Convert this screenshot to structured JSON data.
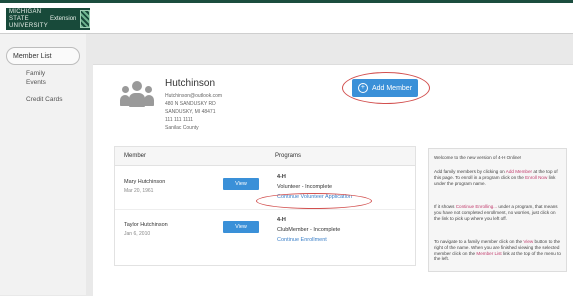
{
  "header": {
    "logo_line1": "MICHIGAN STATE UNIVERSITY",
    "logo_line2": "Extension"
  },
  "sidebar": {
    "member_list_label": "Member List",
    "items": [
      {
        "label": "Family"
      },
      {
        "label": "Events"
      },
      {
        "label": "Credit Cards"
      }
    ]
  },
  "household": {
    "name": "Hutchinson",
    "email": "Hutchinson@outlook.com",
    "address1": "480 N SANDUSKY RD",
    "address2": "SANDUSKY, MI 48471",
    "phone": "111 111 1111",
    "county": "Sanilac County"
  },
  "add_member_label": "Add Member",
  "table": {
    "col_member": "Member",
    "col_programs": "Programs",
    "rows": [
      {
        "name": "Mary Hutchinson",
        "date": "Mar 20, 1961",
        "view_label": "View",
        "program": "4-H",
        "status": "Volunteer - Incomplete",
        "link": "Continue Volunteer Application"
      },
      {
        "name": "Taylor Hutchinson",
        "date": "Jan 6, 2010",
        "view_label": "View",
        "program": "4-H",
        "status": "ClubMember - Incomplete",
        "link": "Continue Enrollment"
      }
    ]
  },
  "info_panel": {
    "p1": "Welcome to the new version of 4-H Online!",
    "p2a": "Add family members by clicking on ",
    "p2b": "Add Member",
    "p2c": " at the top of this page. To enroll in a program click on the ",
    "p2d": "Enroll Now",
    "p2e": " link under the program name.",
    "p3a": "If it shows ",
    "p3b": "Continue Enrolling...",
    "p3c": " under a program, that means you have not completed enrollment, no worries, just click on the link to pick up where you left off.",
    "p4a": "To navigate to a family member click on the ",
    "p4b": "View",
    "p4c": " button to the right of the name. When you are finished viewing the selected member click on the ",
    "p4d": "Member List",
    "p4e": " link at the top of the menu to the left."
  }
}
